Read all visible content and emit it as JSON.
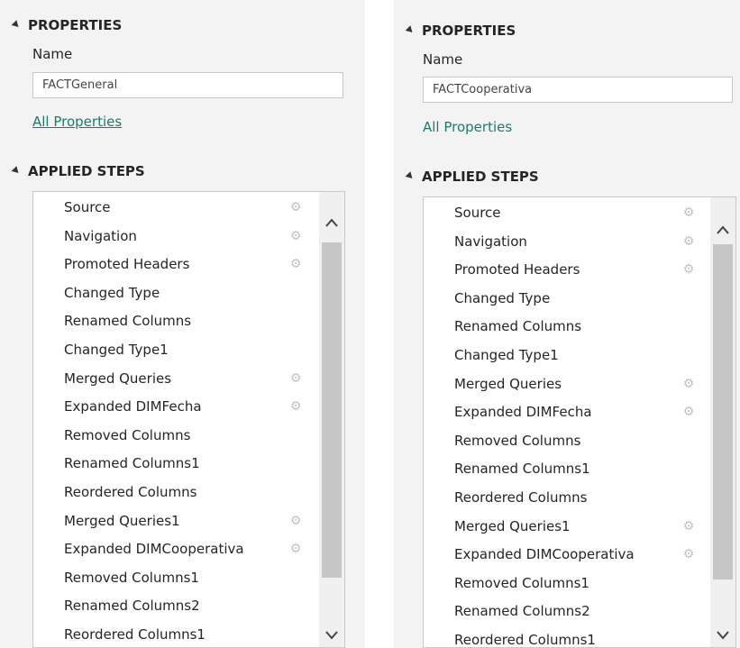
{
  "left": {
    "properties_header": "PROPERTIES",
    "name_label": "Name",
    "name_value": "FACTGeneral",
    "all_properties": "All Properties",
    "applied_steps_header": "APPLIED STEPS",
    "steps": [
      {
        "label": "Source",
        "gear": true
      },
      {
        "label": "Navigation",
        "gear": true
      },
      {
        "label": "Promoted Headers",
        "gear": true
      },
      {
        "label": "Changed Type",
        "gear": false
      },
      {
        "label": "Renamed Columns",
        "gear": false
      },
      {
        "label": "Changed Type1",
        "gear": false
      },
      {
        "label": "Merged Queries",
        "gear": true
      },
      {
        "label": "Expanded DIMFecha",
        "gear": true
      },
      {
        "label": "Removed Columns",
        "gear": false
      },
      {
        "label": "Renamed Columns1",
        "gear": false
      },
      {
        "label": "Reordered Columns",
        "gear": false
      },
      {
        "label": "Merged Queries1",
        "gear": true
      },
      {
        "label": "Expanded DIMCooperativa",
        "gear": true
      },
      {
        "label": "Removed Columns1",
        "gear": false
      },
      {
        "label": "Renamed Columns2",
        "gear": false
      },
      {
        "label": "Reordered Columns1",
        "gear": false
      }
    ]
  },
  "right": {
    "properties_header": "PROPERTIES",
    "name_label": "Name",
    "name_value": "FACTCooperativa",
    "all_properties": "All Properties",
    "applied_steps_header": "APPLIED STEPS",
    "steps": [
      {
        "label": "Source",
        "gear": true
      },
      {
        "label": "Navigation",
        "gear": true
      },
      {
        "label": "Promoted Headers",
        "gear": true
      },
      {
        "label": "Changed Type",
        "gear": false
      },
      {
        "label": "Renamed Columns",
        "gear": false
      },
      {
        "label": "Changed Type1",
        "gear": false
      },
      {
        "label": "Merged Queries",
        "gear": true
      },
      {
        "label": "Expanded DIMFecha",
        "gear": true
      },
      {
        "label": "Removed Columns",
        "gear": false
      },
      {
        "label": "Renamed Columns1",
        "gear": false
      },
      {
        "label": "Reordered Columns",
        "gear": false
      },
      {
        "label": "Merged Queries1",
        "gear": true
      },
      {
        "label": "Expanded DIMCooperativa",
        "gear": true
      },
      {
        "label": "Removed Columns1",
        "gear": false
      },
      {
        "label": "Renamed Columns2",
        "gear": false
      },
      {
        "label": "Reordered Columns1",
        "gear": false
      }
    ]
  },
  "icons": {
    "gear": "gear-icon",
    "collapse": "triangle-collapse-icon",
    "scroll_up": "chevron-up-icon",
    "scroll_down": "chevron-down-icon"
  },
  "colors": {
    "panel_bg": "#f3f3f3",
    "link": "#1f7a6a",
    "gear": "#c2c2c2",
    "scroll_thumb": "#c6c6c6"
  }
}
